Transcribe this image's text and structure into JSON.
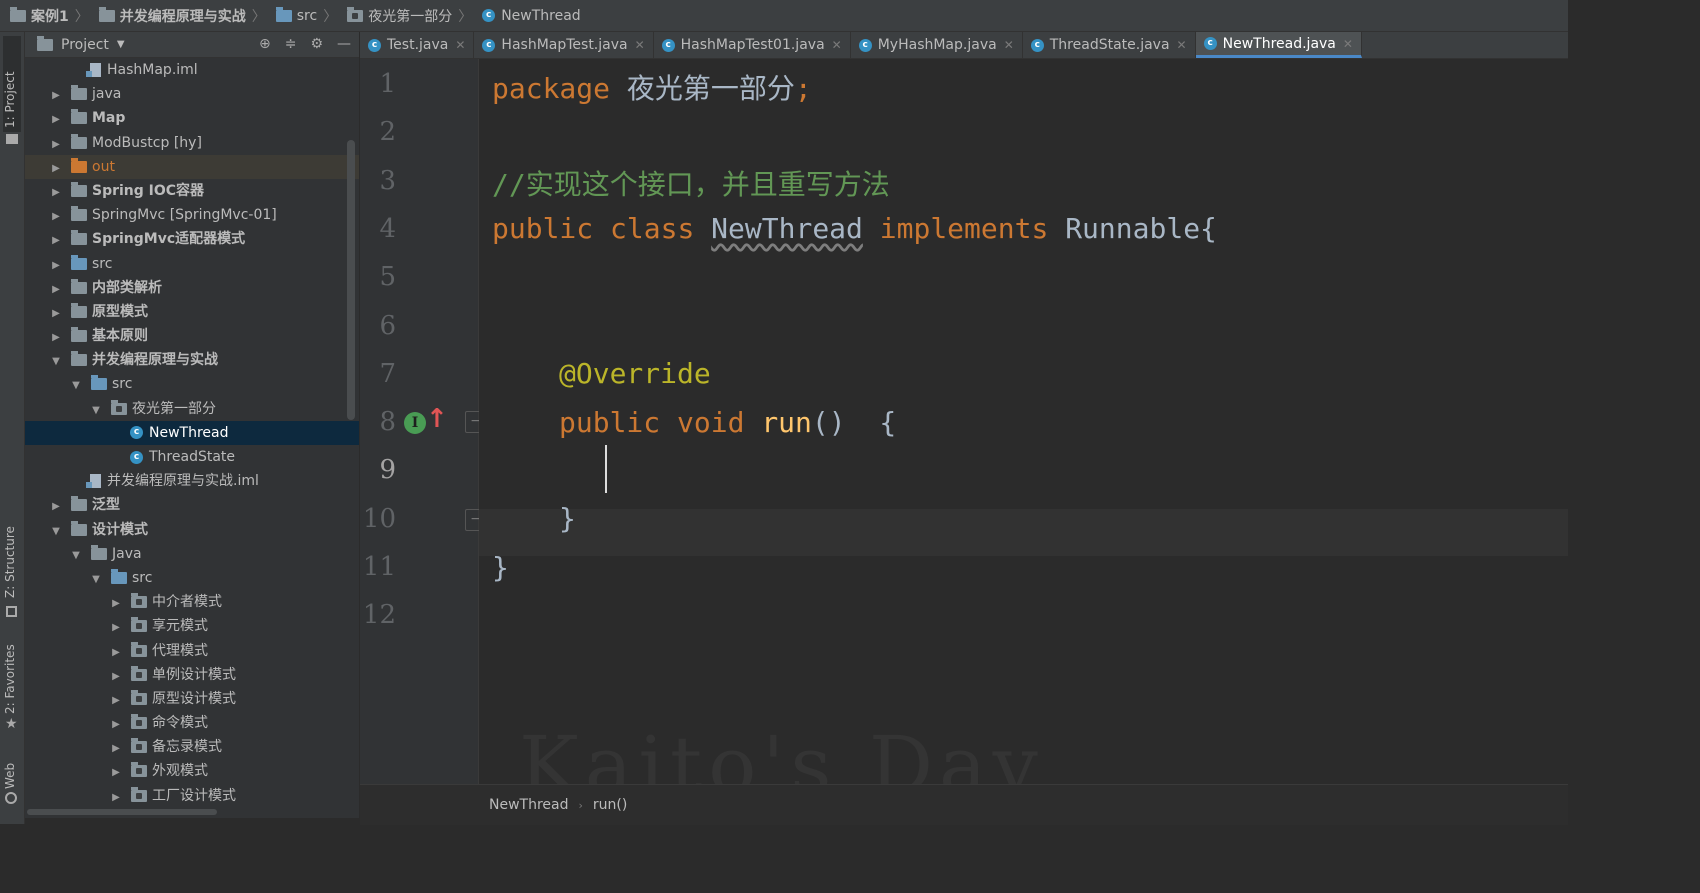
{
  "breadcrumb": [
    "案例1",
    "并发编程原理与实战",
    "src",
    "夜光第一部分",
    "NewThread"
  ],
  "left_strip": {
    "project": "1: Project",
    "structure": "Z: Structure",
    "favorites": "2: Favorites",
    "web": "Web"
  },
  "project_panel": {
    "title": "Project",
    "tree": [
      {
        "label": "HashMap.iml",
        "kind": "iml",
        "indent": 3
      },
      {
        "label": "java",
        "kind": "folder",
        "indent": 1,
        "arrow": "▶"
      },
      {
        "label": "Map",
        "kind": "folder",
        "indent": 1,
        "arrow": "▶",
        "bold": true
      },
      {
        "label": "ModBustcp [hy]",
        "kind": "folder",
        "indent": 1,
        "arrow": "▶"
      },
      {
        "label": "out",
        "kind": "folder-orange",
        "indent": 1,
        "arrow": "▶"
      },
      {
        "label": "Spring IOC容器",
        "kind": "folder",
        "indent": 1,
        "arrow": "▶",
        "bold": true
      },
      {
        "label": "SpringMvc [SpringMvc-01]",
        "kind": "folder",
        "indent": 1,
        "arrow": "▶"
      },
      {
        "label": "SpringMvc适配器模式",
        "kind": "folder",
        "indent": 1,
        "arrow": "▶",
        "bold": true
      },
      {
        "label": "src",
        "kind": "folder-blue",
        "indent": 1,
        "arrow": "▶"
      },
      {
        "label": "内部类解析",
        "kind": "folder",
        "indent": 1,
        "arrow": "▶",
        "bold": true
      },
      {
        "label": "原型模式",
        "kind": "folder",
        "indent": 1,
        "arrow": "▶",
        "bold": true
      },
      {
        "label": "基本原则",
        "kind": "folder",
        "indent": 1,
        "arrow": "▶",
        "bold": true
      },
      {
        "label": "并发编程原理与实战",
        "kind": "folder",
        "indent": 1,
        "arrow": "▼",
        "bold": true
      },
      {
        "label": "src",
        "kind": "folder-blue",
        "indent": 2,
        "arrow": "▼"
      },
      {
        "label": "夜光第一部分",
        "kind": "package",
        "indent": 3,
        "arrow": "▼"
      },
      {
        "label": "NewThread",
        "kind": "class",
        "indent": 5,
        "selected": true
      },
      {
        "label": "ThreadState",
        "kind": "class",
        "indent": 5
      },
      {
        "label": "并发编程原理与实战.iml",
        "kind": "iml",
        "indent": 3
      },
      {
        "label": "泛型",
        "kind": "folder",
        "indent": 1,
        "arrow": "▶",
        "bold": true
      },
      {
        "label": "设计模式",
        "kind": "folder",
        "indent": 1,
        "arrow": "▼",
        "bold": true
      },
      {
        "label": "Java",
        "kind": "folder",
        "indent": 2,
        "arrow": "▼"
      },
      {
        "label": "src",
        "kind": "folder-blue",
        "indent": 3,
        "arrow": "▼"
      },
      {
        "label": "中介者模式",
        "kind": "package",
        "indent": 4,
        "arrow": "▶"
      },
      {
        "label": "享元模式",
        "kind": "package",
        "indent": 4,
        "arrow": "▶"
      },
      {
        "label": "代理模式",
        "kind": "package",
        "indent": 4,
        "arrow": "▶"
      },
      {
        "label": "单例设计模式",
        "kind": "package",
        "indent": 4,
        "arrow": "▶"
      },
      {
        "label": "原型设计模式",
        "kind": "package",
        "indent": 4,
        "arrow": "▶"
      },
      {
        "label": "命令模式",
        "kind": "package",
        "indent": 4,
        "arrow": "▶"
      },
      {
        "label": "备忘录模式",
        "kind": "package",
        "indent": 4,
        "arrow": "▶"
      },
      {
        "label": "外观模式",
        "kind": "package",
        "indent": 4,
        "arrow": "▶"
      },
      {
        "label": "工厂设计模式",
        "kind": "package",
        "indent": 4,
        "arrow": "▶"
      }
    ]
  },
  "tabs": [
    {
      "label": "Test.java"
    },
    {
      "label": "HashMapTest.java"
    },
    {
      "label": "HashMapTest01.java"
    },
    {
      "label": "MyHashMap.java"
    },
    {
      "label": "ThreadState.java"
    },
    {
      "label": "NewThread.java",
      "active": true
    }
  ],
  "editor": {
    "line_numbers": [
      "1",
      "2",
      "3",
      "4",
      "5",
      "6",
      "7",
      "8",
      "9",
      "10",
      "11",
      "12"
    ],
    "current_line": "9",
    "code": {
      "l1_kw": "package",
      "l1_name": " 夜光第一部分",
      "l1_semi": ";",
      "l3_comment": "//实现这个接口，并且重写方法",
      "l4_public": "public",
      "l4_class": " class ",
      "l4_name": "NewThread",
      "l4_impl": " implements ",
      "l4_iface": "Runnable",
      "l4_brace": "{",
      "l7_ann": "@Override",
      "l8_public": "public",
      "l8_void": " void ",
      "l8_run": "run",
      "l8_rest": "()  {",
      "l10_brace": "}",
      "l11_brace": "}"
    },
    "watermark": "Kaito's Day"
  },
  "status_breadcrumb": [
    "NewThread",
    "run()"
  ]
}
